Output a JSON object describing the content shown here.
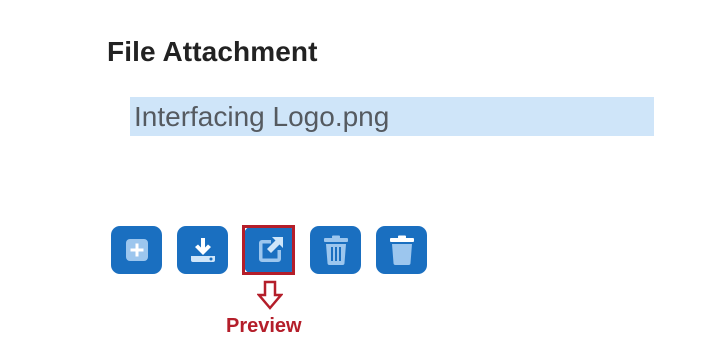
{
  "section": {
    "title": "File Attachment"
  },
  "attachments": [
    {
      "filename": "Interfacing Logo.png"
    }
  ],
  "toolbar": {
    "buttons": [
      {
        "name": "add-button",
        "icon": "plus-square-icon"
      },
      {
        "name": "download-button",
        "icon": "download-icon"
      },
      {
        "name": "preview-button",
        "icon": "open-external-icon"
      },
      {
        "name": "delete-all-button",
        "icon": "trash-can-icon"
      },
      {
        "name": "delete-button",
        "icon": "trash-icon"
      }
    ]
  },
  "annotation": {
    "label": "Preview",
    "color": "#b41e2a"
  },
  "colors": {
    "button_bg": "#1a6fc0",
    "icon_fill": "#cfe5f9",
    "selection_bg": "#cfe5f9"
  }
}
